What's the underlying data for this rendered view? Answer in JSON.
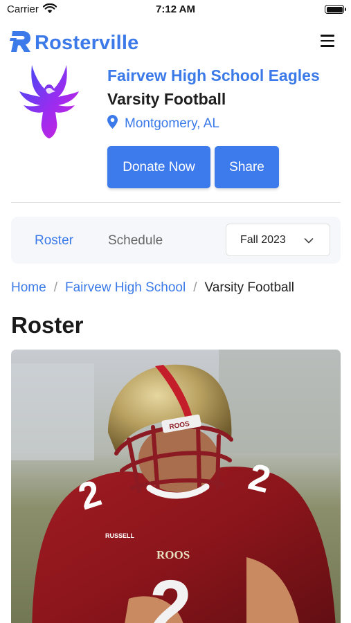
{
  "status_bar": {
    "carrier": "Carrier",
    "time": "7:12 AM"
  },
  "header": {
    "brand_name": "Rosterville",
    "brand_color": "#3b7ae8",
    "menu_icon": "hamburger-menu-icon"
  },
  "team": {
    "name": "Fairvew High School Eagles",
    "level": "Varsity Football",
    "location": "Montgomery, AL",
    "logo_icon": "eagle-logo-icon",
    "donate_label": "Donate Now",
    "share_label": "Share"
  },
  "tabs": {
    "items": [
      {
        "label": "Roster",
        "active": true
      },
      {
        "label": "Schedule",
        "active": false
      }
    ],
    "season": {
      "selected": "Fall 2023"
    }
  },
  "breadcrumb": {
    "items": [
      "Home",
      "Fairvew High School",
      "Varsity Football"
    ],
    "separator": "/"
  },
  "page": {
    "title": "Roster"
  },
  "photo": {
    "jersey_number": "2",
    "helmet_text": "ROOS",
    "chest_text": "ROOS",
    "brand_mark": "RUSSELL"
  },
  "colors": {
    "accent": "#3b7ae8",
    "button": "#3d7bec",
    "tabs_background": "#f5f7fb"
  }
}
